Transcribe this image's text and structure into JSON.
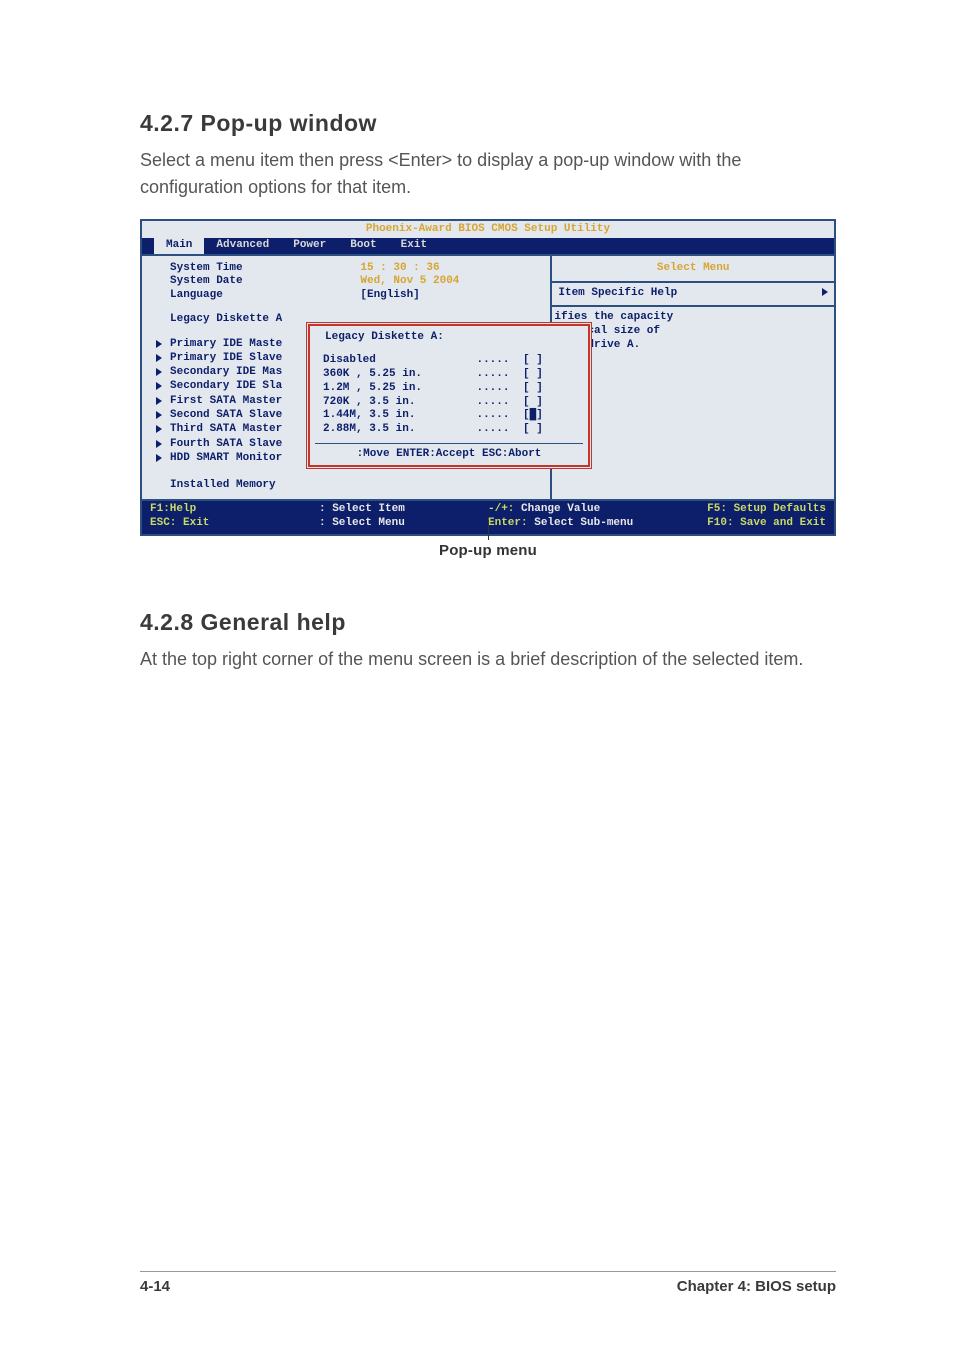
{
  "sec427": {
    "heading": "4.2.7   Pop-up window",
    "para": "Select a menu item then press <Enter> to display a pop-up window with the configuration options for that item."
  },
  "bios": {
    "title": "Phoenix-Award BIOS CMOS Setup Utility",
    "tabs": {
      "main": "Main",
      "advanced": "Advanced",
      "power": "Power",
      "boot": "Boot",
      "exit": "Exit"
    },
    "rows": {
      "systime_k": "System Time",
      "systime_v": "15 : 30 : 36",
      "sysdate_k": "System Date",
      "sysdate_v": "Wed, Nov 5 2004",
      "lang_k": "Language",
      "lang_v": "[English]",
      "legacy": "Legacy Diskette A",
      "items": [
        "Primary IDE Maste",
        "Primary IDE Slave",
        "Secondary IDE Mas",
        "Secondary IDE Sla",
        "First SATA Master",
        "Second SATA Slave",
        "Third SATA Master",
        "Fourth SATA Slave",
        "HDD SMART Monitor"
      ],
      "installed": "Installed Memory"
    },
    "popup": {
      "title": "Legacy Diskette A:",
      "opts": [
        {
          "nm": "Disabled",
          "dots": ".....",
          "br": "[ ]"
        },
        {
          "nm": "360K , 5.25 in.",
          "dots": ".....",
          "br": "[ ]"
        },
        {
          "nm": "1.2M , 5.25 in.",
          "dots": ".....",
          "br": "[ ]"
        },
        {
          "nm": "720K , 3.5 in.",
          "dots": ".....",
          "br": "[ ]"
        },
        {
          "nm": "1.44M, 3.5 in.",
          "dots": ".....",
          "br": "[█]"
        },
        {
          "nm": "2.88M, 3.5 in.",
          "dots": ".....",
          "br": "[ ]"
        }
      ],
      "keys": ":Move  ENTER:Accept  ESC:Abort"
    },
    "right": {
      "select_menu": "Select Menu",
      "item_help": "Item Specific Help",
      "help_text1": "ifies the capacity",
      "help_text2": "physical size of",
      "help_text3": "ette drive A."
    },
    "footer": {
      "r1a": "F1:Help",
      "r1b": ": Select Item",
      "r1c": "-/+:",
      "r1d": "Change Value",
      "r1e": "F5: Setup Defaults",
      "r2a": "ESC: Exit",
      "r2b": ": Select Menu",
      "r2c": "Enter:",
      "r2d": "Select Sub-menu",
      "r2e": "F10: Save and Exit"
    }
  },
  "caption": "Pop-up menu",
  "sec428": {
    "heading": "4.2.8   General help",
    "para": "At the top right corner of the menu screen is a brief description of the selected item."
  },
  "pagefoot": {
    "left": "4-14",
    "right": "Chapter 4: BIOS setup"
  }
}
